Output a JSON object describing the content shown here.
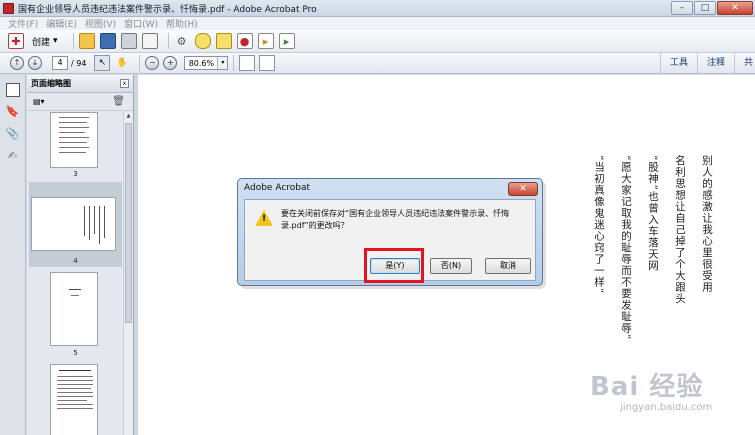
{
  "window": {
    "title": "国有企业领导人员违纪违法案件警示录、忏悔录.pdf - Adobe Acrobat Pro",
    "minimize_glyph": "–",
    "maximize_glyph": "□",
    "close_glyph": "✕"
  },
  "menu": {
    "items": [
      "文件(F)",
      "编辑(E)",
      "视图(V)",
      "窗口(W)",
      "帮助(H)"
    ]
  },
  "toolbar": {
    "create_label": "创建",
    "create_caret": "▾",
    "icons": [
      "create-pdf-icon",
      "open-folder-icon",
      "save-icon",
      "print-icon",
      "email-icon",
      "settings-icon",
      "comment-icon",
      "stamp-icon",
      "sign-icon",
      "export-icon",
      "share-icon"
    ]
  },
  "nav": {
    "prev_glyph": "↑",
    "next_glyph": "↓",
    "current_page": "4",
    "total_pages": "/ 94",
    "select_glyph": "↖",
    "hand_glyph": "✋",
    "zoom_out_glyph": "−",
    "zoom_in_glyph": "+",
    "zoom_value": "80.6%",
    "zoom_caret": "▾",
    "tabs": [
      "工具",
      "注释",
      "共"
    ]
  },
  "panel": {
    "title": "页面缩略图",
    "close_glyph": "x",
    "options_glyph": "▤▾",
    "trash_glyph": "🗑",
    "thumb_labels": [
      "3",
      "4",
      "5"
    ]
  },
  "document": {
    "columns": [
      "别人的感激让我心里很受用",
      "名利思想让自己掉了个大跟头",
      "“股神”也曾入车落天网",
      "“愿大家记取我的耻辱而不要发耻辱”",
      "“当初真像鬼迷心窍了一样”"
    ]
  },
  "dialog": {
    "title": "Adobe Acrobat",
    "close_glyph": "✕",
    "warn_glyph": "!",
    "message": "要在关闭前保存对“国有企业领导人员违纪违法案件警示录、忏悔录.pdf”的更改吗？",
    "yes_label": "是(Y)",
    "no_label": "否(N)",
    "cancel_label": "取消"
  },
  "watermark": {
    "text": "Bai 经验",
    "sub": "jingyan.baidu.com"
  }
}
